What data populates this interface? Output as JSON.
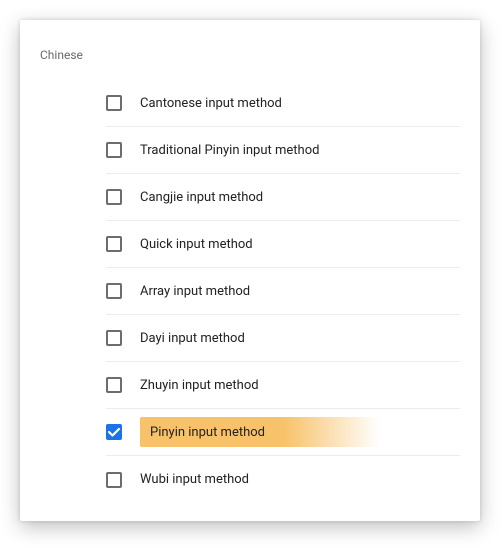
{
  "section": {
    "label": "Chinese"
  },
  "items": [
    {
      "label": "Cantonese input method",
      "checked": false,
      "highlighted": false
    },
    {
      "label": "Traditional Pinyin input method",
      "checked": false,
      "highlighted": false
    },
    {
      "label": "Cangjie input method",
      "checked": false,
      "highlighted": false
    },
    {
      "label": "Quick input method",
      "checked": false,
      "highlighted": false
    },
    {
      "label": "Array input method",
      "checked": false,
      "highlighted": false
    },
    {
      "label": "Dayi input method",
      "checked": false,
      "highlighted": false
    },
    {
      "label": "Zhuyin input method",
      "checked": false,
      "highlighted": false
    },
    {
      "label": "Pinyin input method",
      "checked": true,
      "highlighted": true
    },
    {
      "label": "Wubi input method",
      "checked": false,
      "highlighted": false
    }
  ],
  "colors": {
    "accent": "#1a73e8",
    "highlight": "#f8c26a"
  }
}
